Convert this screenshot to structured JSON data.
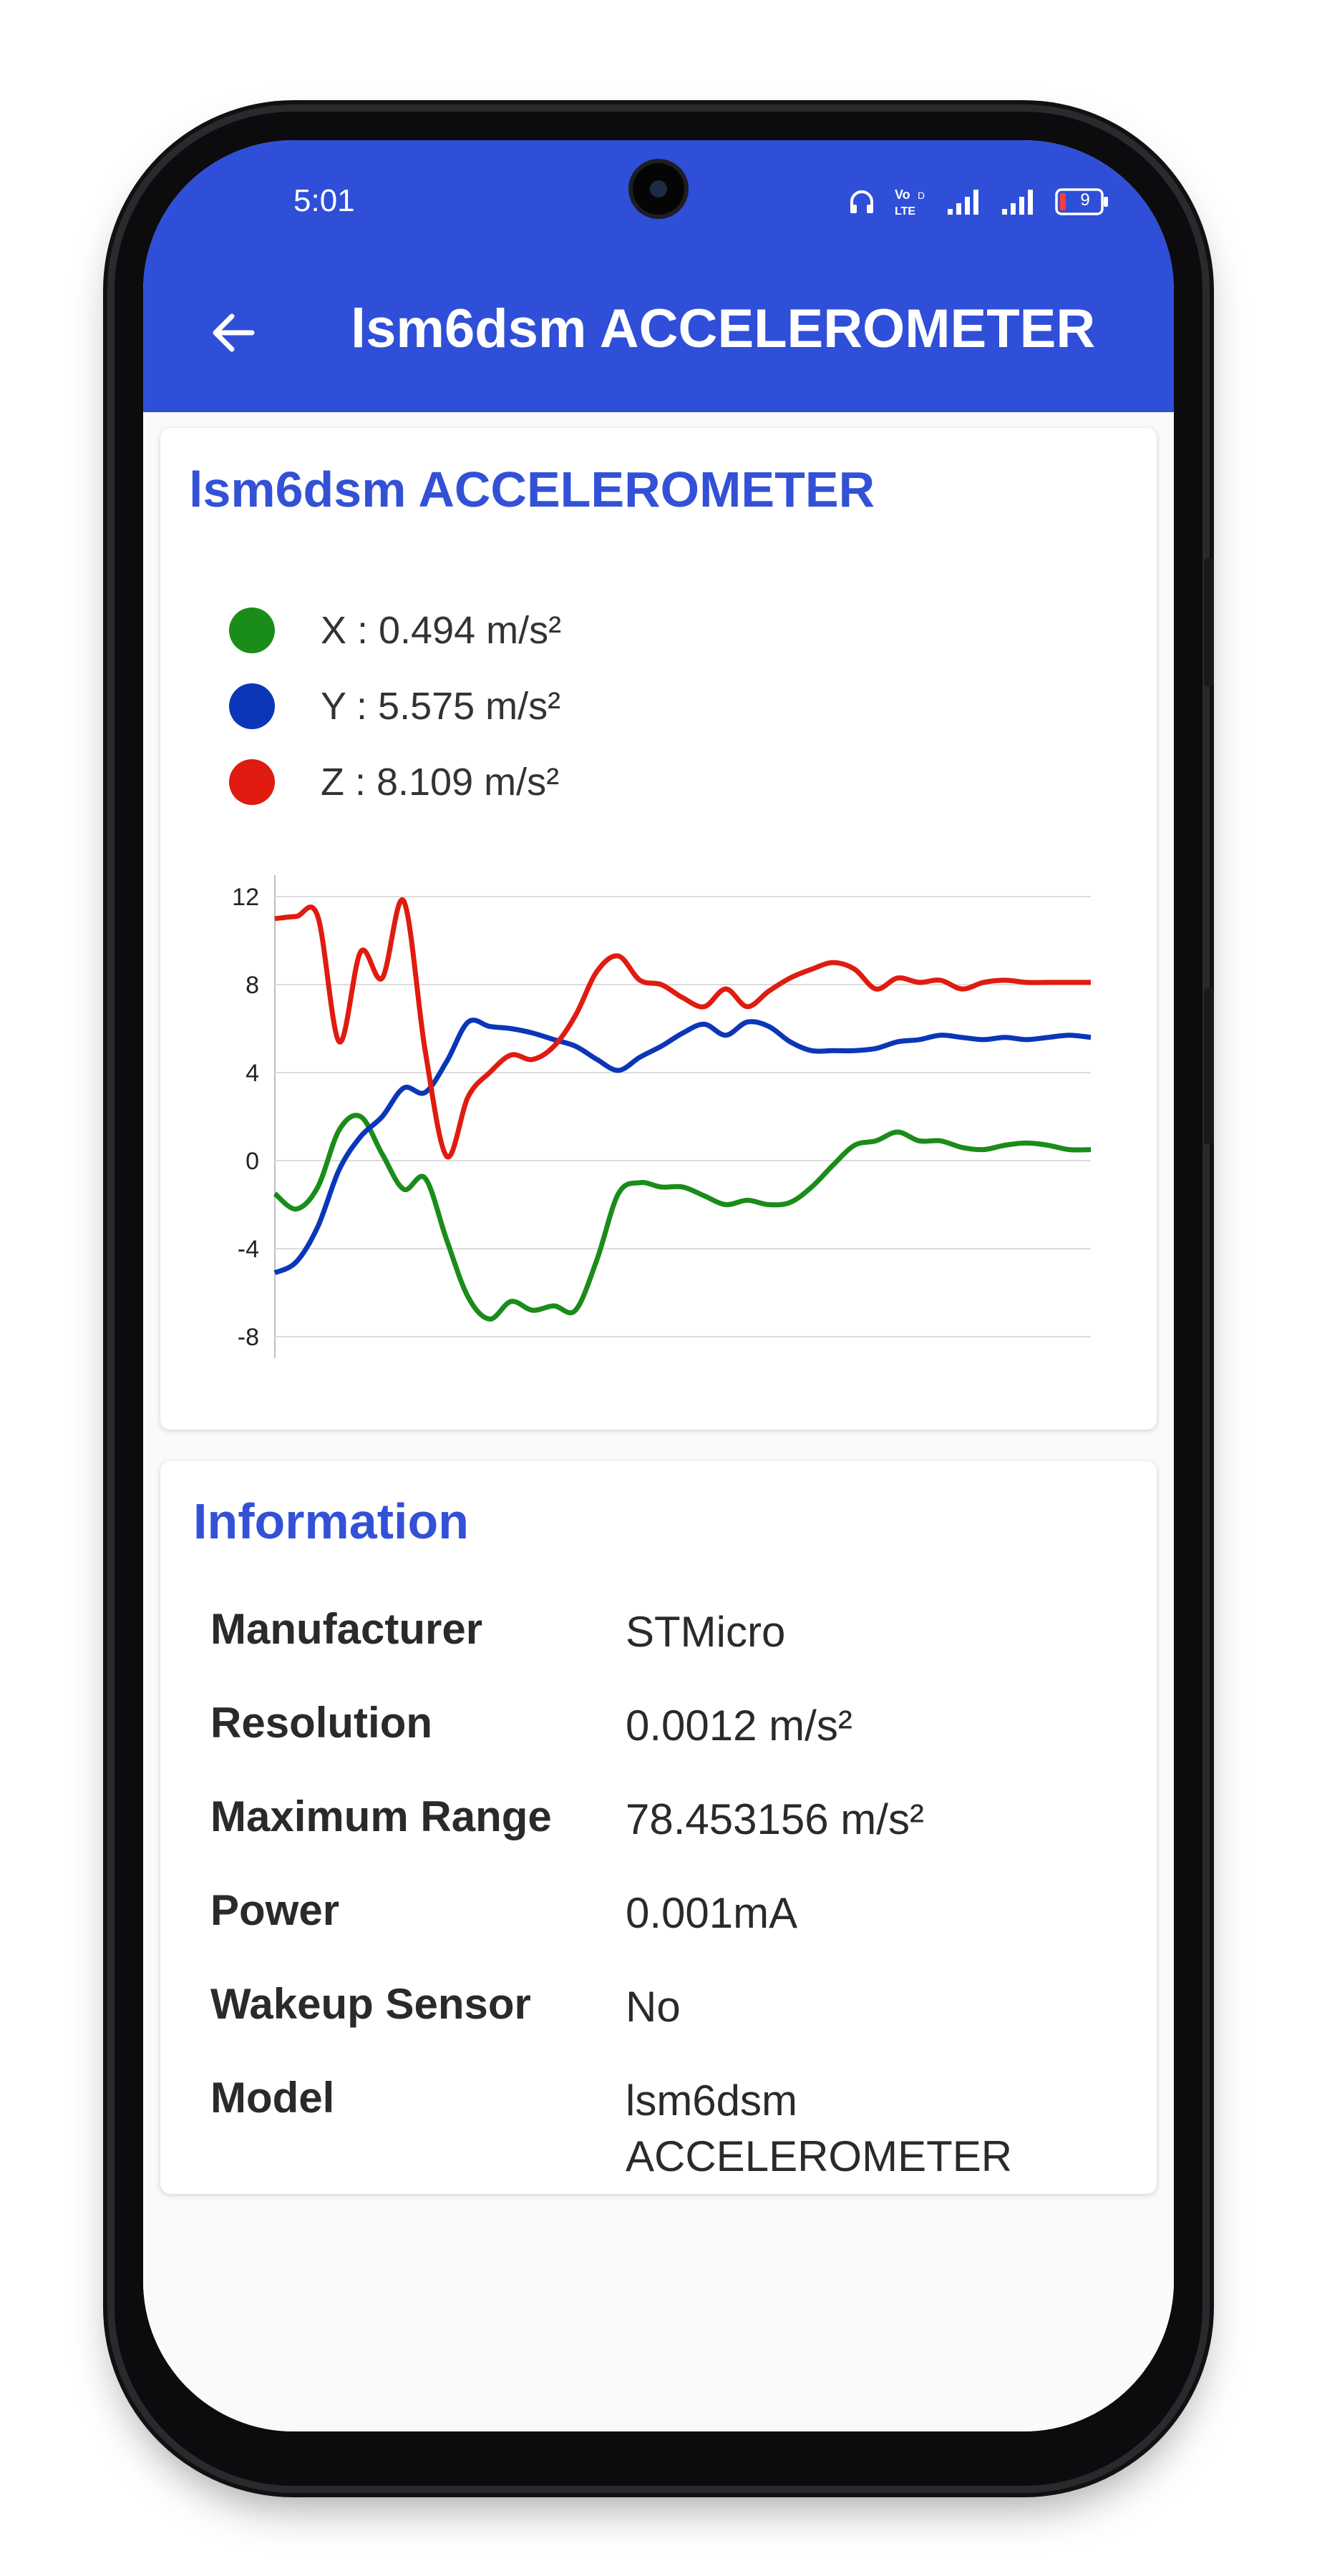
{
  "status_bar": {
    "time": "5:01",
    "battery_level": "9"
  },
  "app_bar": {
    "title": "lsm6dsm ACCELEROMETER",
    "back_icon": "arrow-left-icon"
  },
  "sensor_card": {
    "title": "lsm6dsm ACCELEROMETER",
    "legend": [
      {
        "label": "X : 0.494 m/s²",
        "color": "#1a8c1a"
      },
      {
        "label": "Y : 5.575 m/s²",
        "color": "#0b36b8"
      },
      {
        "label": "Z : 8.109 m/s²",
        "color": "#e01b0f"
      }
    ]
  },
  "chart_data": {
    "type": "line",
    "ylim": [
      -8,
      12
    ],
    "yticks": [
      12,
      8,
      4,
      0,
      -4,
      -8
    ],
    "ytick_labels": [
      "12",
      "8",
      "4",
      "0",
      "-4",
      "-8"
    ],
    "grid": true,
    "series": [
      {
        "name": "X",
        "color": "#1a8c1a",
        "values": [
          -1.5,
          -2.2,
          -1.2,
          1.4,
          2.0,
          0.3,
          -1.3,
          -0.8,
          -3.6,
          -6.2,
          -7.2,
          -6.4,
          -6.8,
          -6.6,
          -6.8,
          -4.5,
          -1.5,
          -1.0,
          -1.2,
          -1.2,
          -1.6,
          -2.0,
          -1.8,
          -2.0,
          -1.9,
          -1.2,
          -0.2,
          0.7,
          0.9,
          1.3,
          0.9,
          0.9,
          0.6,
          0.5,
          0.7,
          0.8,
          0.7,
          0.5,
          0.5
        ]
      },
      {
        "name": "Y",
        "color": "#0b36b8",
        "values": [
          -5.1,
          -4.6,
          -3.0,
          -0.4,
          1.1,
          2.0,
          3.3,
          3.1,
          4.5,
          6.3,
          6.1,
          6.0,
          5.8,
          5.5,
          5.2,
          4.6,
          4.1,
          4.7,
          5.2,
          5.8,
          6.2,
          5.7,
          6.3,
          6.1,
          5.4,
          5.0,
          5.0,
          5.0,
          5.1,
          5.4,
          5.5,
          5.7,
          5.6,
          5.5,
          5.6,
          5.5,
          5.6,
          5.7,
          5.6
        ]
      },
      {
        "name": "Z",
        "color": "#e01b0f",
        "values": [
          11.0,
          11.1,
          11.1,
          5.4,
          9.5,
          8.3,
          11.8,
          5.0,
          0.2,
          2.9,
          4.0,
          4.8,
          4.6,
          5.2,
          6.6,
          8.6,
          9.3,
          8.2,
          8.0,
          7.4,
          7.0,
          7.8,
          7.0,
          7.7,
          8.3,
          8.7,
          9.0,
          8.7,
          7.8,
          8.3,
          8.1,
          8.2,
          7.8,
          8.1,
          8.2,
          8.1,
          8.1,
          8.1,
          8.1
        ]
      }
    ]
  },
  "info_card": {
    "title": "Information",
    "rows": [
      {
        "label": "Manufacturer",
        "value": "STMicro"
      },
      {
        "label": "Resolution",
        "value": "0.0012 m/s²"
      },
      {
        "label": "Maximum Range",
        "value": "78.453156 m/s²"
      },
      {
        "label": "Power",
        "value": "0.001mA"
      },
      {
        "label": "Wakeup Sensor",
        "value": "No"
      },
      {
        "label": "Model",
        "value": "lsm6dsm ACCELEROMETER"
      }
    ]
  }
}
